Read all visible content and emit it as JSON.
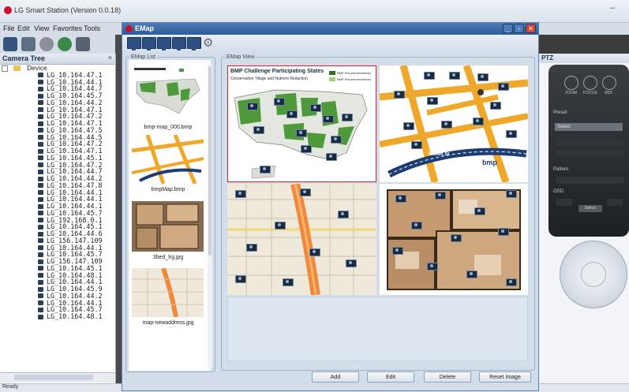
{
  "main_window": {
    "title": "LG Smart Station (Version 0.0.18)",
    "minimize": "–"
  },
  "menu": [
    "File",
    "Edit",
    "View",
    "Favorites",
    "Tools"
  ],
  "camera_tree": {
    "header": "Camera Tree",
    "close": "×",
    "root": "Device",
    "items": [
      "LG_10.164.47.1",
      "LG_10.164.44.1",
      "LG_10.164.44.7",
      "LG_10.164.45.7",
      "LG_10.164.44.2",
      "LG_10.164.47.1",
      "LG_10.164.47.2",
      "LG_10.164.47.1",
      "LG_10.164.47.5",
      "LG_10.164.44.5",
      "LG_10.164.47.2",
      "LG_10.164.47.1",
      "LG_10.164.45.1",
      "LG_10.164.47.2",
      "LG_10.164.44.7",
      "LG_10.164.44.2",
      "LG_10.164.47.8",
      "LG_10.164.44.1",
      "LG_10.164.44.1",
      "LG_10.164.44.1",
      "LG_10.164.45.7",
      "LG_192.168.0.1",
      "LG_10.164.45.1",
      "LG_10.164.44.6",
      "LG_156.147.109",
      "LG_10.164.44.1",
      "LG_10.164.45.7",
      "LG_156.147.109",
      "LG_10.164.45.1",
      "LG_10.164.48.1",
      "LG_10.164.44.1",
      "LG_10.164.45.9",
      "LG_10.164.44.2",
      "LG_10.164.44.1",
      "LG_10.164.45.7",
      "LG_10.164.48.1"
    ]
  },
  "status": {
    "text": "Ready"
  },
  "emap": {
    "title": "EMap",
    "list_legend": "EMap List",
    "view_legend": "EMap View",
    "maps": [
      {
        "file": "bmp-map_000.bmp"
      },
      {
        "file": "bmpMap.bmp"
      },
      {
        "file": "3bed_lrg.jpg"
      },
      {
        "file": "map-newaddress.jpg"
      }
    ],
    "bmp_map": {
      "title": "BMP Challenge Participating States",
      "subtitle": "Conservation Tillage and Nutrient Reduction"
    },
    "street_map": {
      "road_label": "Brown St",
      "logo": "bmp"
    },
    "buttons": {
      "add": "Add",
      "edit": "Edit",
      "delete": "Delete",
      "reset": "Reset Image"
    }
  },
  "ptz": {
    "header": "PTZ",
    "labels": [
      "ZOOM",
      "FOCUS",
      "IRIS"
    ],
    "preset": "Preset",
    "preset_value": "Select",
    "pattern": "Pattern",
    "osd": "OSD",
    "select": "Select"
  },
  "colors": {
    "emap_title": "#2e5a98",
    "selection_border": "#c02a2a",
    "road": "#f0a82a",
    "state_green": "#4e9a3a"
  }
}
